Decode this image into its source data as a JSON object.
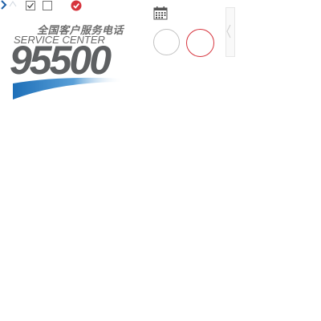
{
  "logo": {
    "chinese_text": "全国客户服务电话",
    "english_text": "SERVICE CENTER",
    "number": "95500",
    "colors": {
      "text": "#5e6062",
      "swoosh": "#1d6fb8"
    }
  },
  "icons": {
    "chevron": "chevron-right-icon",
    "triangle": "triangle-up-icon",
    "checkbox_checked": "checkbox-checked-icon",
    "checkbox_unchecked": "checkbox-unchecked-icon",
    "check_circle": "check-circle-icon",
    "calendar": "calendar-icon"
  },
  "colors": {
    "accent_red": "#d6343d",
    "neutral_border": "#c2c2c2",
    "icon_blue": "#1d5fa6"
  }
}
